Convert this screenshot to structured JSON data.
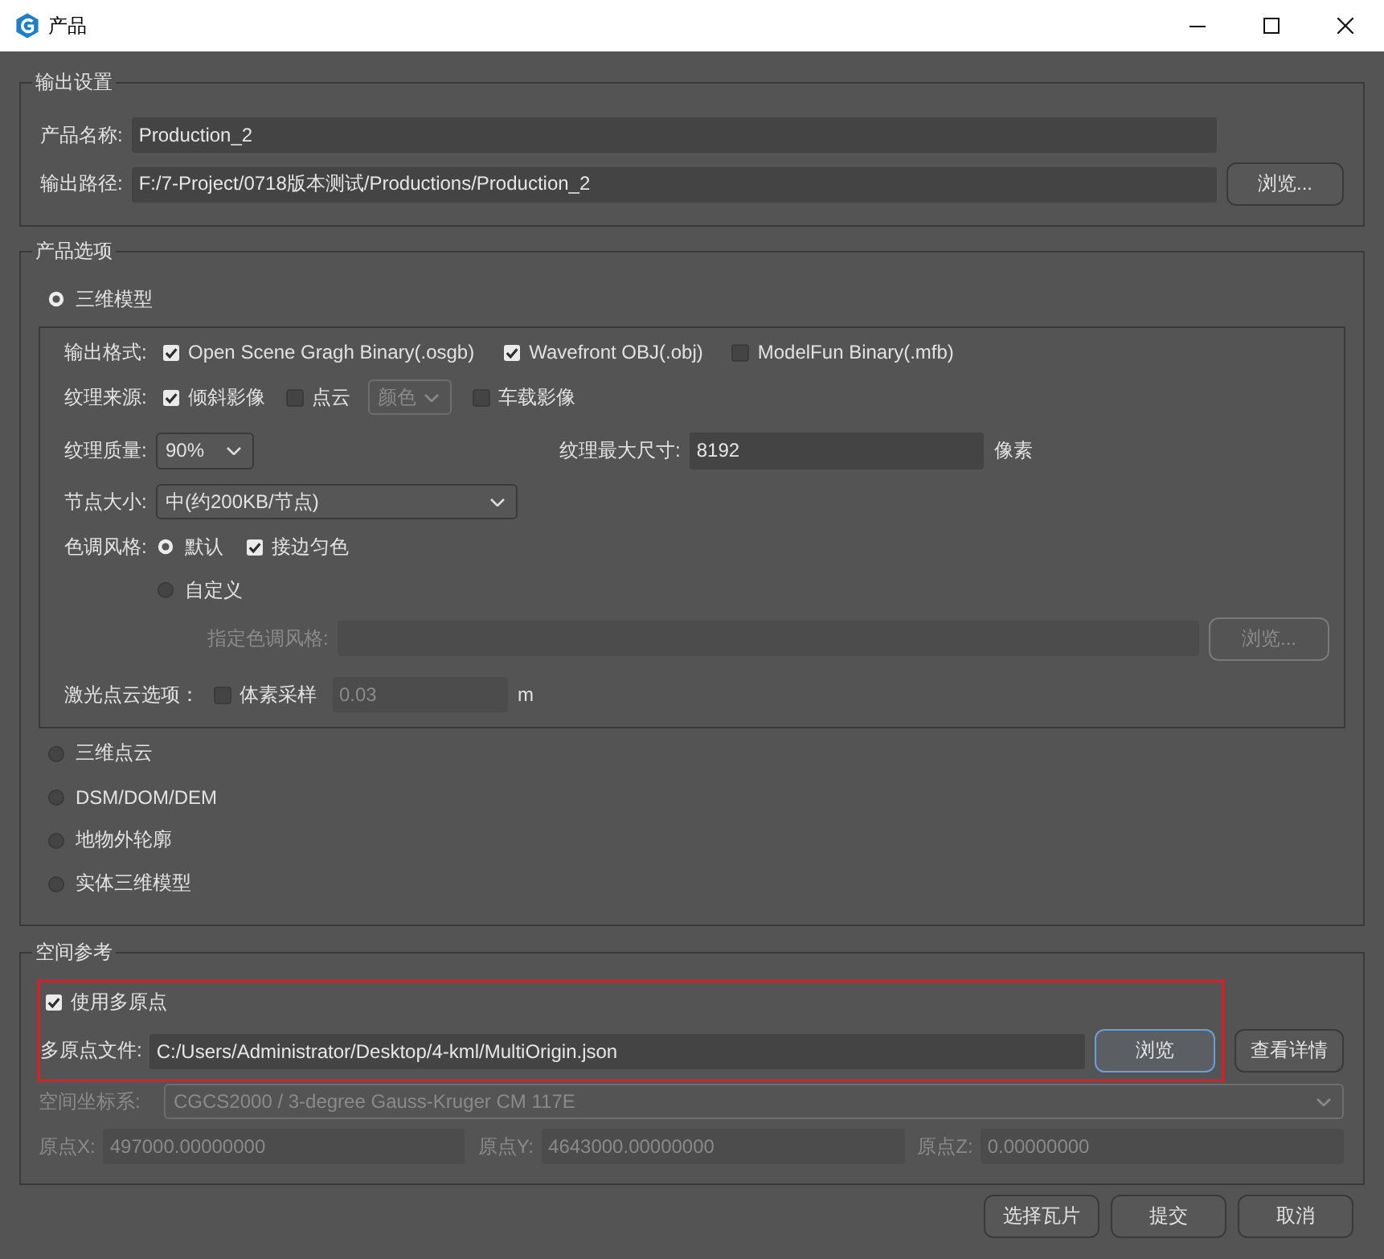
{
  "window": {
    "title": "产品"
  },
  "output_settings": {
    "title": "输出设置",
    "fields": [
      {
        "label": "产品名称:",
        "value": "Production_2"
      },
      {
        "label": "输出路径:",
        "value": "F:/7-Project/0718版本测试/Productions/Production_2",
        "button": "浏览..."
      }
    ]
  },
  "product_options": {
    "title": "产品选项",
    "types": [
      {
        "label": "三维模型",
        "selected": true,
        "settings": {
          "output_format": {
            "label": "输出格式:",
            "options": [
              {
                "label": "Open Scene Gragh Binary(.osgb)",
                "checked": true
              },
              {
                "label": "Wavefront OBJ(.obj)",
                "checked": true
              },
              {
                "label": "ModelFun Binary(.mfb)",
                "checked": false
              }
            ]
          },
          "texture_source": {
            "label": "纹理来源:",
            "items": [
              {
                "kind": "checkbox",
                "label": "倾斜影像",
                "checked": true
              },
              {
                "kind": "checkbox",
                "label": "点云",
                "checked": false
              },
              {
                "kind": "dropdown",
                "value": "颜色",
                "disabled": true
              },
              {
                "kind": "checkbox",
                "label": "车载影像",
                "checked": false
              }
            ]
          },
          "texture_quality": {
            "label": "纹理质量:",
            "value": "90%"
          },
          "max_texture_size": {
            "label": "纹理最大尺寸:",
            "value": "8192",
            "unit": "像素"
          },
          "node_size": {
            "label": "节点大小:",
            "value": "中(约200KB/节点)"
          },
          "color_style": {
            "label": "色调风格:",
            "options": [
              {
                "label": "默认",
                "selected": true
              },
              {
                "label": "自定义",
                "selected": false
              }
            ],
            "edge_blending": {
              "label": "接边匀色",
              "checked": true
            },
            "style_file": {
              "label": "指定色调风格:",
              "button": "浏览...",
              "disabled": true
            }
          },
          "lidar_options": {
            "label": "激光点云选项：",
            "voxel_sampling": {
              "label": "体素采样",
              "checked": false
            },
            "field": {
              "value": "0.03",
              "disabled": true
            },
            "unit": "m"
          }
        }
      },
      {
        "label": "三维点云",
        "selected": false
      },
      {
        "label": "DSM/DOM/DEM",
        "selected": false
      },
      {
        "label": "地物外轮廓",
        "selected": false
      },
      {
        "label": "实体三维模型",
        "selected": false
      }
    ]
  },
  "spatial_reference": {
    "title": "空间参考",
    "highlighted": true,
    "use_multi_origin": {
      "label": "使用多原点",
      "checked": true
    },
    "origin_file": {
      "label": "多原点文件:",
      "value": "C:/Users/Administrator/Desktop/4-kml/MultiOrigin.json",
      "button": {
        "label": "浏览",
        "focused": true
      }
    },
    "details_button": "查看详情",
    "crs": {
      "label": "空间坐标系:",
      "value": "CGCS2000 / 3-degree Gauss-Kruger CM 117E",
      "disabled": true
    },
    "origin": {
      "disabled": true,
      "fields": [
        {
          "label": "原点X:",
          "value": "497000.00000000"
        },
        {
          "label": "原点Y:",
          "value": "4643000.00000000"
        },
        {
          "label": "原点Z:",
          "value": "0.00000000"
        }
      ]
    }
  },
  "buttons": [
    "选择瓦片",
    "提交",
    "取消"
  ]
}
